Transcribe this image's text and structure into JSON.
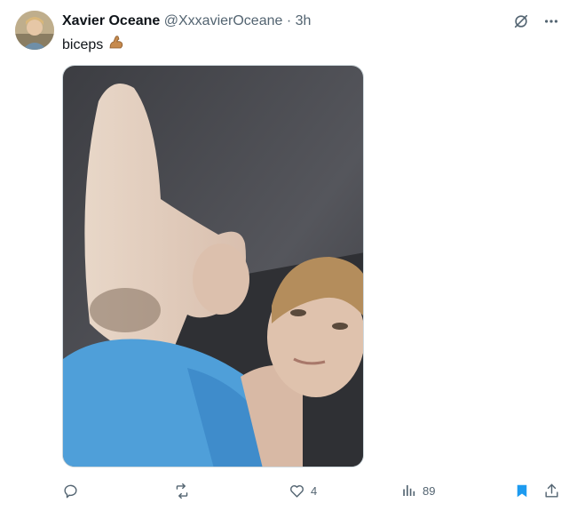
{
  "author": {
    "display_name": "Xavier Oceane",
    "handle": "@XxxavierOceane",
    "separator": "·",
    "time": "3h"
  },
  "tweet": {
    "text": "biceps",
    "emoji_icon": "flexed-biceps-icon"
  },
  "top_icons": [
    "grok-icon",
    "more-options-icon"
  ],
  "media": {
    "description_icon": "photo"
  },
  "actions": {
    "reply_count": "",
    "retweet_count": "",
    "like_count": "4",
    "views_count": "89"
  },
  "colors": {
    "text_primary": "#0f1419",
    "text_secondary": "#536471",
    "bookmark_blue": "#1d9bf0",
    "shirt_blue": "#4f9fd9"
  }
}
